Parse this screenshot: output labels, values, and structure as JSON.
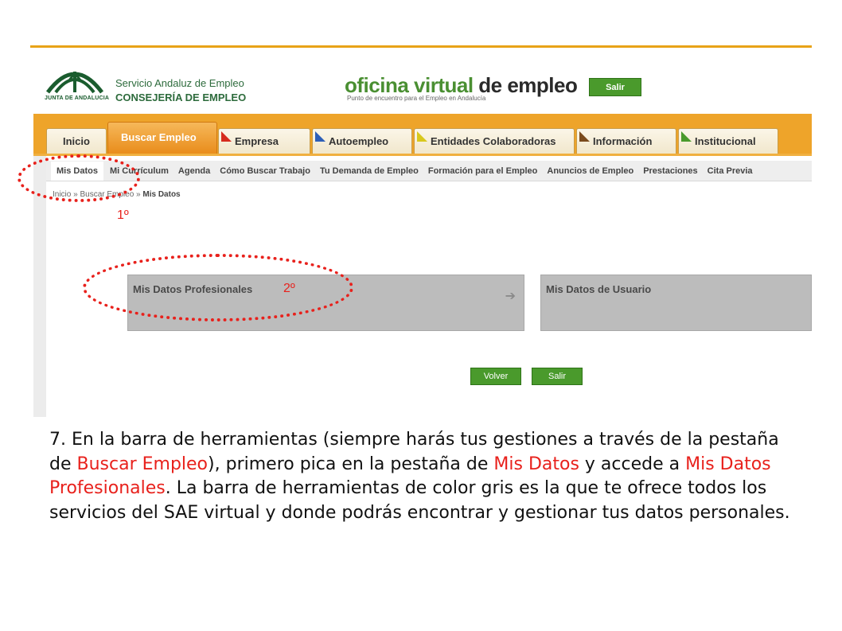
{
  "header": {
    "logo_caption": "JUNTA DE ANDALUCIA",
    "org_line1": "Servicio Andaluz de Empleo",
    "org_line2": "CONSEJERÍA DE EMPLEO",
    "brand_part1": "oficina virtual ",
    "brand_part2": "de empleo",
    "brand_sub": "Punto de encuentro para el Empleo en Andalucía",
    "salir_label": "Salir"
  },
  "tabs": [
    {
      "label": "Inicio",
      "flag_color": ""
    },
    {
      "label": "Buscar Empleo",
      "flag_color": ""
    },
    {
      "label": "Empresa",
      "flag_color": "#d62b1e"
    },
    {
      "label": "Autoempleo",
      "flag_color": "#2d5fb8"
    },
    {
      "label": "Entidades Colaboradoras",
      "flag_color": "#d8c81c"
    },
    {
      "label": "Información",
      "flag_color": "#7a4a1c"
    },
    {
      "label": "Institucional",
      "flag_color": "#4a9a2c"
    }
  ],
  "subnav": [
    "Mis Datos",
    "Mi Currículum",
    "Agenda",
    "Cómo Buscar Trabajo",
    "Tu Demanda de Empleo",
    "Formación para el Empleo",
    "Anuncios de Empleo",
    "Prestaciones",
    "Cita Previa"
  ],
  "breadcrumb": {
    "part1": "Inicio » Buscar Empleo » ",
    "current": "Mis Datos"
  },
  "panels": {
    "profesionales": "Mis Datos Profesionales",
    "arrow": "➔",
    "usuario": "Mis Datos de Usuario"
  },
  "buttons": {
    "volver": "Volver",
    "salir": "Salir"
  },
  "annotations": {
    "first": "1º",
    "second": "2º"
  },
  "caption": {
    "t1": "7. En la barra de herramientas (siempre harás tus gestiones a través de la pestaña de ",
    "r1": "Buscar Empleo",
    "t2": "), primero pica en la pestaña de ",
    "r2": "Mis Datos",
    "t3": " y accede a ",
    "r3": "Mis Datos Profesionales",
    "t4": ". La barra de herramientas de color gris es la que te ofrece todos los servicios del SAE virtual y donde podrás encontrar y gestionar tus datos personales."
  },
  "colors": {
    "accent_orange": "#eea42a",
    "brand_green": "#4a8f32",
    "annotation_red": "#e8211c"
  }
}
